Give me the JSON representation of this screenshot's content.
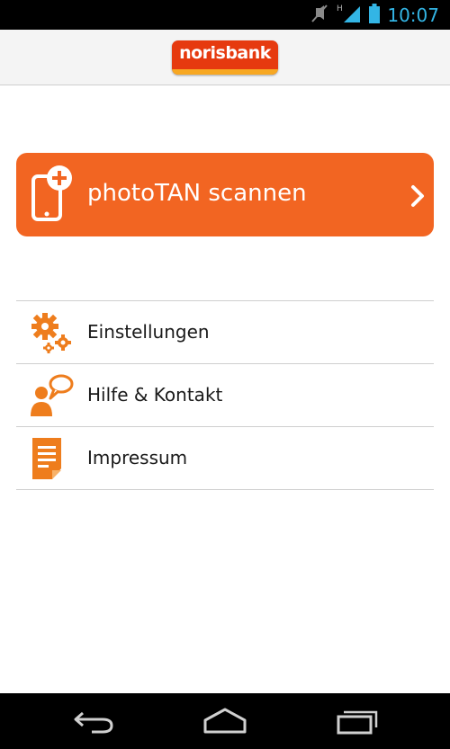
{
  "status_bar": {
    "time": "10:07",
    "icons": [
      "mute-icon",
      "signal-h-icon",
      "battery-icon"
    ],
    "network_label": "H"
  },
  "header": {
    "logo_text": "norisbank"
  },
  "scan": {
    "label": "photoTAN scannen",
    "icon": "phone-plus-icon"
  },
  "menu": {
    "items": [
      {
        "label": "Einstellungen",
        "icon": "gears-icon"
      },
      {
        "label": "Hilfe & Kontakt",
        "icon": "person-speech-icon"
      },
      {
        "label": "Impressum",
        "icon": "document-icon"
      }
    ]
  },
  "nav": {
    "buttons": [
      "back-icon",
      "home-icon",
      "recent-apps-icon"
    ]
  },
  "colors": {
    "accent": "#f26522",
    "brand_red": "#e63a0f",
    "brand_yellow": "#f7a823",
    "status_time": "#33b5e5",
    "icon_orange": "#ee7d1d"
  }
}
